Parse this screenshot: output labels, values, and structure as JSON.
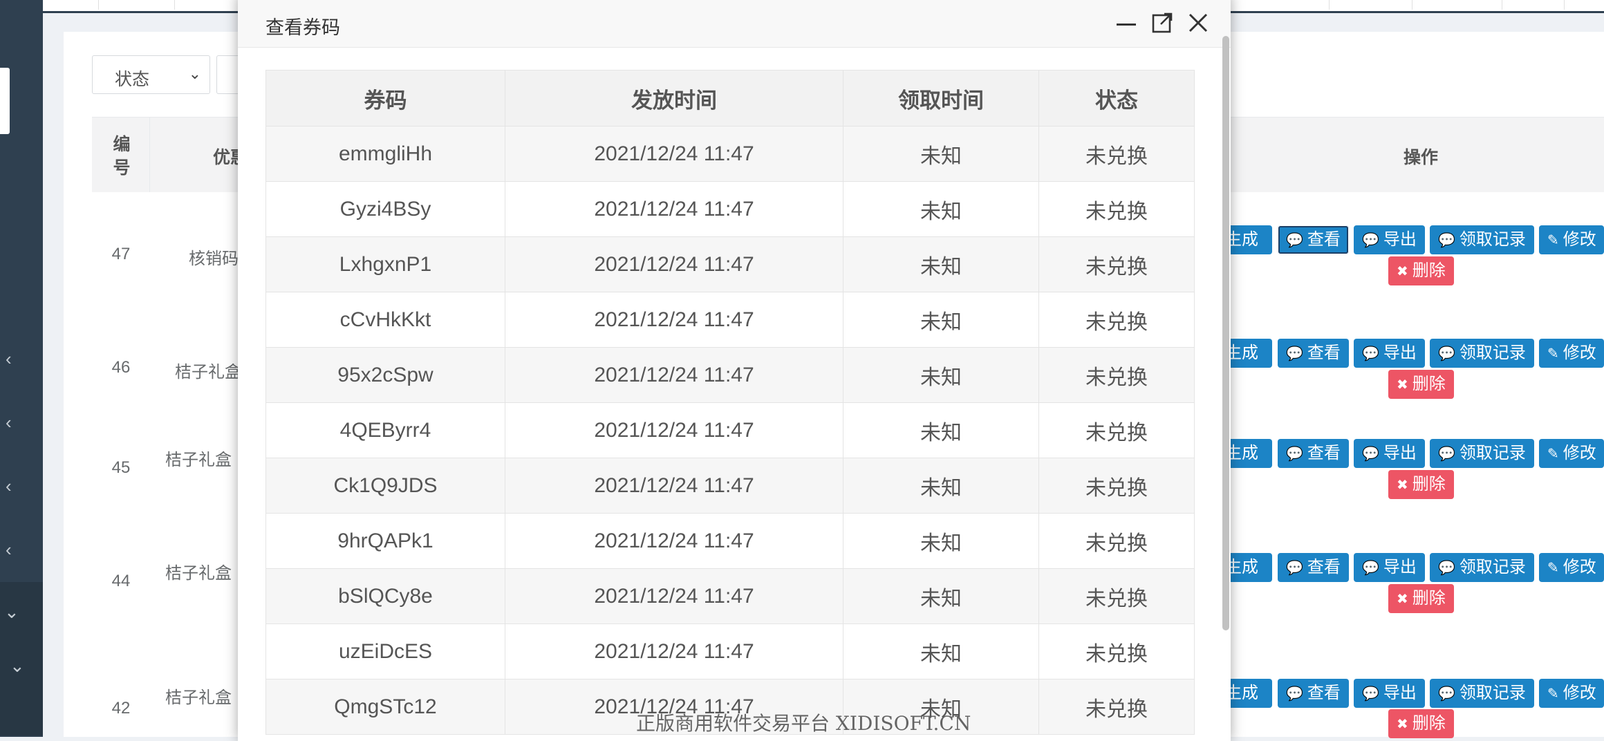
{
  "sidebar": {
    "chevrons": [
      "‹",
      "‹",
      "‹",
      "‹",
      "⌄",
      "⌄"
    ]
  },
  "filter": {
    "status_label": "状态",
    "status_arrow": "⌄"
  },
  "list_table": {
    "headers": {
      "id": "编号",
      "name": "优惠",
      "actions": "操作"
    },
    "rows": [
      {
        "id": "47",
        "name": "核销码"
      },
      {
        "id": "46",
        "name": "桔子礼盒"
      },
      {
        "id": "45",
        "name": "桔子礼盒"
      },
      {
        "id": "44",
        "name": "桔子礼盒"
      },
      {
        "id": "42",
        "name": "桔子礼盒"
      }
    ],
    "actions": {
      "generate": "生成",
      "view": "查看",
      "export": "导出",
      "records": "领取记录",
      "edit": "修改",
      "delete": "删除"
    }
  },
  "modal": {
    "title": "查看券码",
    "columns": [
      "券码",
      "发放时间",
      "领取时间",
      "状态"
    ],
    "rows": [
      {
        "code": "emmgliHh",
        "issued": "2021/12/24 11:47",
        "claimed": "未知",
        "status": "未兑换"
      },
      {
        "code": "Gyzi4BSy",
        "issued": "2021/12/24 11:47",
        "claimed": "未知",
        "status": "未兑换"
      },
      {
        "code": "LxhgxnP1",
        "issued": "2021/12/24 11:47",
        "claimed": "未知",
        "status": "未兑换"
      },
      {
        "code": "cCvHkKkt",
        "issued": "2021/12/24 11:47",
        "claimed": "未知",
        "status": "未兑换"
      },
      {
        "code": "95x2cSpw",
        "issued": "2021/12/24 11:47",
        "claimed": "未知",
        "status": "未兑换"
      },
      {
        "code": "4QEByrr4",
        "issued": "2021/12/24 11:47",
        "claimed": "未知",
        "status": "未兑换"
      },
      {
        "code": "Ck1Q9JDS",
        "issued": "2021/12/24 11:47",
        "claimed": "未知",
        "status": "未兑换"
      },
      {
        "code": "9hrQAPk1",
        "issued": "2021/12/24 11:47",
        "claimed": "未知",
        "status": "未兑换"
      },
      {
        "code": "bSlQCy8e",
        "issued": "2021/12/24 11:47",
        "claimed": "未知",
        "status": "未兑换"
      },
      {
        "code": "uzEiDcES",
        "issued": "2021/12/24 11:47",
        "claimed": "未知",
        "status": "未兑换"
      },
      {
        "code": "QmgSTc12",
        "issued": "2021/12/24 11:47",
        "claimed": "未知",
        "status": "未兑换"
      }
    ]
  },
  "watermark": "正版商用软件交易平台 XIDISOFT.CN"
}
